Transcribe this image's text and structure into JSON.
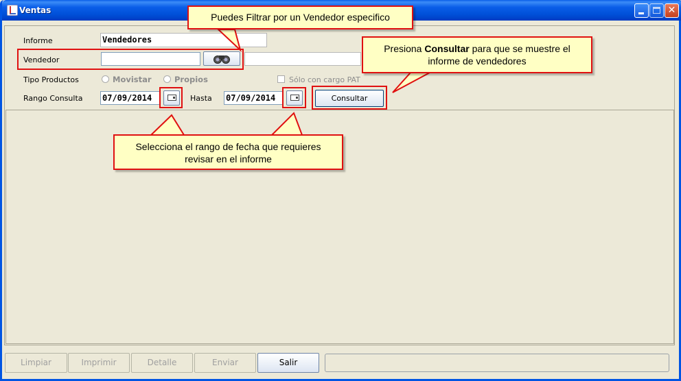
{
  "window": {
    "title": "Ventas"
  },
  "form": {
    "informe_label": "Informe",
    "informe_value": "Vendedores",
    "vendedor_label": "Vendedor",
    "vendedor_value": "",
    "tipo_label": "Tipo Productos",
    "radio1": "Movistar",
    "radio2": "Propios",
    "checkbox_label": "Sólo con cargo PAT",
    "rango_label": "Rango Consulta",
    "fecha_desde": "07/09/2014",
    "hasta_label": "Hasta",
    "fecha_hasta": "07/09/2014",
    "consultar_label": "Consultar"
  },
  "callouts": {
    "vendedor_tip": "Puedes Filtrar por un Vendedor especifico",
    "consultar_pre": "Presiona ",
    "consultar_bold": "Consultar",
    "consultar_post": " para que se muestre el informe de vendedores",
    "fecha_tip": "Selecciona el rango de fecha que requieres revisar en el informe"
  },
  "bottom": {
    "limpiar": "Limpiar",
    "imprimir": "Imprimir",
    "detalle": "Detalle",
    "enviar": "Enviar",
    "salir": "Salir"
  },
  "colors": {
    "highlight": "#e01010",
    "callout_bg": "#ffffc4",
    "titlebar": "#0a5ee8"
  }
}
